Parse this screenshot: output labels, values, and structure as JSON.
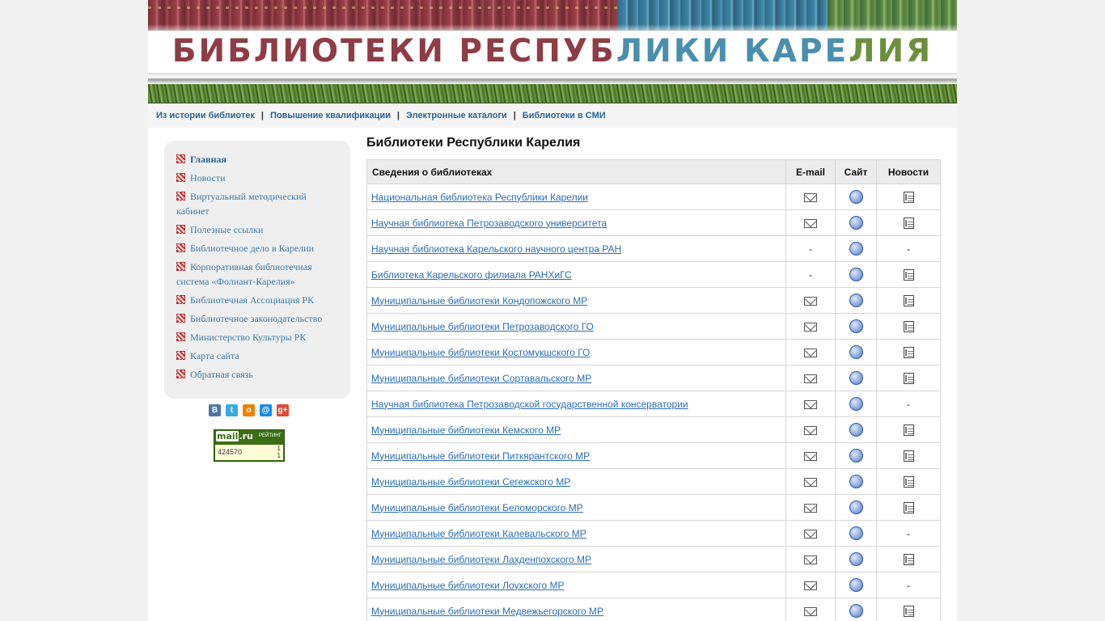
{
  "banner": {
    "title_part1": "БИБЛИОТЕКИ РЕСПУБ",
    "title_part2": "ЛИКИ КАРЕ",
    "title_part3": "ЛИЯ"
  },
  "topnav": {
    "items": [
      {
        "label": "Из истории библиотек"
      },
      {
        "label": "Повышение квалификации"
      },
      {
        "label": "Электронные каталоги"
      },
      {
        "label": "Библиотеки в СМИ"
      }
    ],
    "separator": "|"
  },
  "sidebar": {
    "items": [
      {
        "label": "Главная",
        "active": true
      },
      {
        "label": "Новости"
      },
      {
        "label": "Виртуальный методический кабинет"
      },
      {
        "label": "Полезные ссылки"
      },
      {
        "label": "Библиотечное дело в Карелии"
      },
      {
        "label": "Корпоративная библиотечная система «Фолиант-Карелия»"
      },
      {
        "label": "Библиотечная Ассоциация РК"
      },
      {
        "label": "Библиотечное законодательство"
      },
      {
        "label": "Министерство Культуры РК"
      },
      {
        "label": "Карта сайта"
      },
      {
        "label": "Обратная связь"
      }
    ]
  },
  "social": {
    "buttons": [
      {
        "icon": "vk-icon",
        "glyph": "В",
        "color": "#4a76a8"
      },
      {
        "icon": "twitter-icon",
        "glyph": "t",
        "color": "#3ba9e2"
      },
      {
        "icon": "odnoklassniki-icon",
        "glyph": "о",
        "color": "#ee8208"
      },
      {
        "icon": "mailru-icon",
        "glyph": "@",
        "color": "#168de2"
      },
      {
        "icon": "googleplus-icon",
        "glyph": "g+",
        "color": "#dd4b39"
      }
    ]
  },
  "counter": {
    "logo_mail": "mail",
    "logo_ru": ".ru",
    "rating_label": "РЕЙТИНГ",
    "value": "424570",
    "small_top": "1",
    "small_bottom": "1"
  },
  "main": {
    "title": "Библиотеки Республики Карелия",
    "table": {
      "headers": {
        "name": "Сведения о библиотеках",
        "email": "E-mail",
        "site": "Сайт",
        "news": "Новости"
      },
      "rows": [
        {
          "name": "Национальная библиотека Республики Карелии",
          "email": true,
          "site": true,
          "news": true
        },
        {
          "name": "Научная библиотека Петрозаводского университета",
          "email": true,
          "site": true,
          "news": true
        },
        {
          "name": "Научная библиотека Карельского научного центра РАН",
          "email": false,
          "site": true,
          "news": false
        },
        {
          "name": "Библиотека Карельского филиала РАНХиГС",
          "email": false,
          "site": true,
          "news": true
        },
        {
          "name": "Муниципальные библиотеки Кондопожского МР",
          "email": true,
          "site": true,
          "news": true
        },
        {
          "name": "Муниципальные библиотеки Петрозаводского ГО",
          "email": true,
          "site": true,
          "news": true
        },
        {
          "name": "Муниципальные библиотеки Костомукшского ГО",
          "email": true,
          "site": true,
          "news": true
        },
        {
          "name": "Муниципальные библиотеки Сортавальского МР",
          "email": true,
          "site": true,
          "news": true
        },
        {
          "name": "Научная библиотека Петрозаводской государственной консерватории",
          "email": true,
          "site": true,
          "news": false
        },
        {
          "name": "Муниципальные библиотеки Кемского МР",
          "email": true,
          "site": true,
          "news": true
        },
        {
          "name": "Муниципальные библиотеки Питкярантского МР",
          "email": true,
          "site": true,
          "news": true
        },
        {
          "name": "Муниципальные библиотеки Сегежского МР",
          "email": true,
          "site": true,
          "news": true
        },
        {
          "name": "Муниципальные библиотеки Беломорского МР",
          "email": true,
          "site": true,
          "news": true
        },
        {
          "name": "Муниципальные библиотеки Калевальского МР",
          "email": true,
          "site": true,
          "news": false
        },
        {
          "name": "Муниципальные библиотеки Лахденпохского МР",
          "email": true,
          "site": true,
          "news": true
        },
        {
          "name": "Муниципальные библиотеки Лоухского МР",
          "email": true,
          "site": true,
          "news": false
        },
        {
          "name": "Муниципальные библиотеки Медвежьегорского МР",
          "email": true,
          "site": true,
          "news": true
        }
      ],
      "empty_mark": "-"
    }
  }
}
